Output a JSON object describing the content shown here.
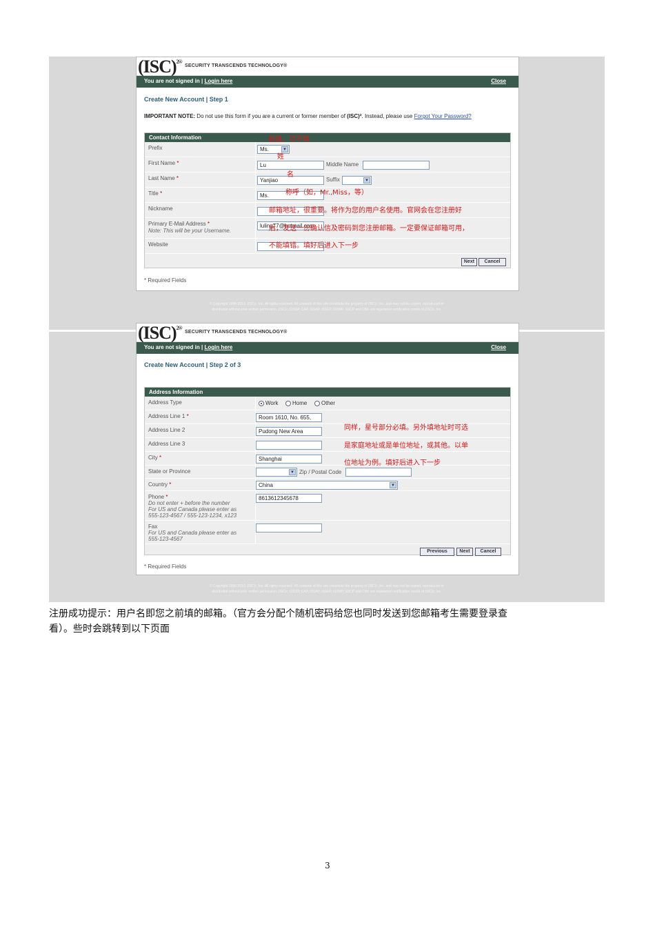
{
  "brand": {
    "logo": "(ISC)",
    "logo_sup": "2®",
    "tagline": "SECURITY TRANSCENDS TECHNOLOGY®"
  },
  "status": {
    "prefix": "You are not signed in | ",
    "login": "Login here",
    "close": "Close"
  },
  "step1": {
    "title": "Create New Account | Step 1",
    "note_bold": "IMPORTANT NOTE:",
    "note_text": " Do not use this form if you are a current or former member of ",
    "note_org": "(ISC)²",
    "note_tail": ". Instead, please use ",
    "note_link": "Forgot Your Password?",
    "section": "Contact Information",
    "labels": {
      "prefix": "Prefix",
      "first_name": "First Name",
      "middle_name": "Middle Name",
      "last_name": "Last Name",
      "suffix": "Suffix",
      "title": "Title",
      "nickname": "Nickname",
      "email": "Primary E-Mail Address",
      "email_note": "Note: This will be your Username.",
      "website": "Website"
    },
    "values": {
      "prefix": "Ms.",
      "first_name": "Lu",
      "last_name": "Yanjiao",
      "title": "Ms.",
      "email": "luling77@hotmail.com"
    },
    "required_mark": "*",
    "buttons": {
      "next": "Next",
      "cancel": "Cancel"
    },
    "required_fields": "* Required Fields",
    "footer": [
      "© Copyright 1996-2010. (ISC)², Inc. All rights reserved. All contents of this site constitute the property of (ISC)², Inc. and may not be copied, reproduced or",
      "distributed without prior written permission. (ISC)², CISSP, CAP, ISSAP, ISSEP, ISSMP, SSCP and CBK are registered certification marks of (ISC)², Inc."
    ],
    "annotations": {
      "prefix": "前缀，可不填",
      "first_name": "姓",
      "last_name": "名",
      "title": "称呼（如，Mr.,Miss，等）",
      "email1": "邮箱地址，很重要。将作为您的用户名使用。官网会在您注册好",
      "email2": "后，发送一份确认信及密码到您注册邮箱。一定要保证邮箱可用，",
      "email3": "不能填错。填好后进入下一步"
    }
  },
  "step2": {
    "title": "Create New Account | Step 2 of 3",
    "section": "Address Information",
    "labels": {
      "address_type": "Address Type",
      "line1": "Address Line 1",
      "line2": "Address Line 2",
      "line3": "Address Line 3",
      "city": "City",
      "state": "State or Province",
      "zip": "Zip / Postal Code",
      "country": "Country",
      "phone": "Phone",
      "phone_note1": "Do not enter + before the number",
      "phone_note2": "For US and Canada please enter as",
      "phone_note3": "555-123-4567 / 555-123-1234, x123",
      "fax": "Fax",
      "fax_note1": "For US and Canada please enter as",
      "fax_note2": "555-123-4567"
    },
    "address_types": [
      "Work",
      "Home",
      "Other"
    ],
    "values": {
      "line1": "Room 1610, No. 655,",
      "line2": "Pudong New Area",
      "city": "Shanghai",
      "country": "China",
      "phone": "8613612345678"
    },
    "required_mark": "*",
    "buttons": {
      "previous": "Previous",
      "next": "Next",
      "cancel": "Cancel"
    },
    "required_fields": "* Required Fields",
    "footer": [
      "© Copyright 1996-2010. (ISC)², Inc. All rights reserved. All contents of this site constitute the property of (ISC)², Inc. and may not be copied, reproduced or",
      "distributed without prior written permission. (ISC)², CISSP, CAP, ISSAP, ISSEP, ISSMP, SSCP and CBK are registered certification marks of (ISC)², Inc."
    ],
    "annotations": {
      "line1": "同样，星号部分必填。另外填地址时可选",
      "line2": "是家庭地址或是单位地址，或其他。以单",
      "line3": "位地址为例。填好后进入下一步"
    }
  },
  "paragraph": {
    "line1": "注册成功提示：用户名即您之前填的邮箱。（官方会分配个随机密码给您也同时发送到您邮箱考生需要登录查",
    "line2": "看）。些时会跳转到以下页面"
  },
  "page_number": "3"
}
